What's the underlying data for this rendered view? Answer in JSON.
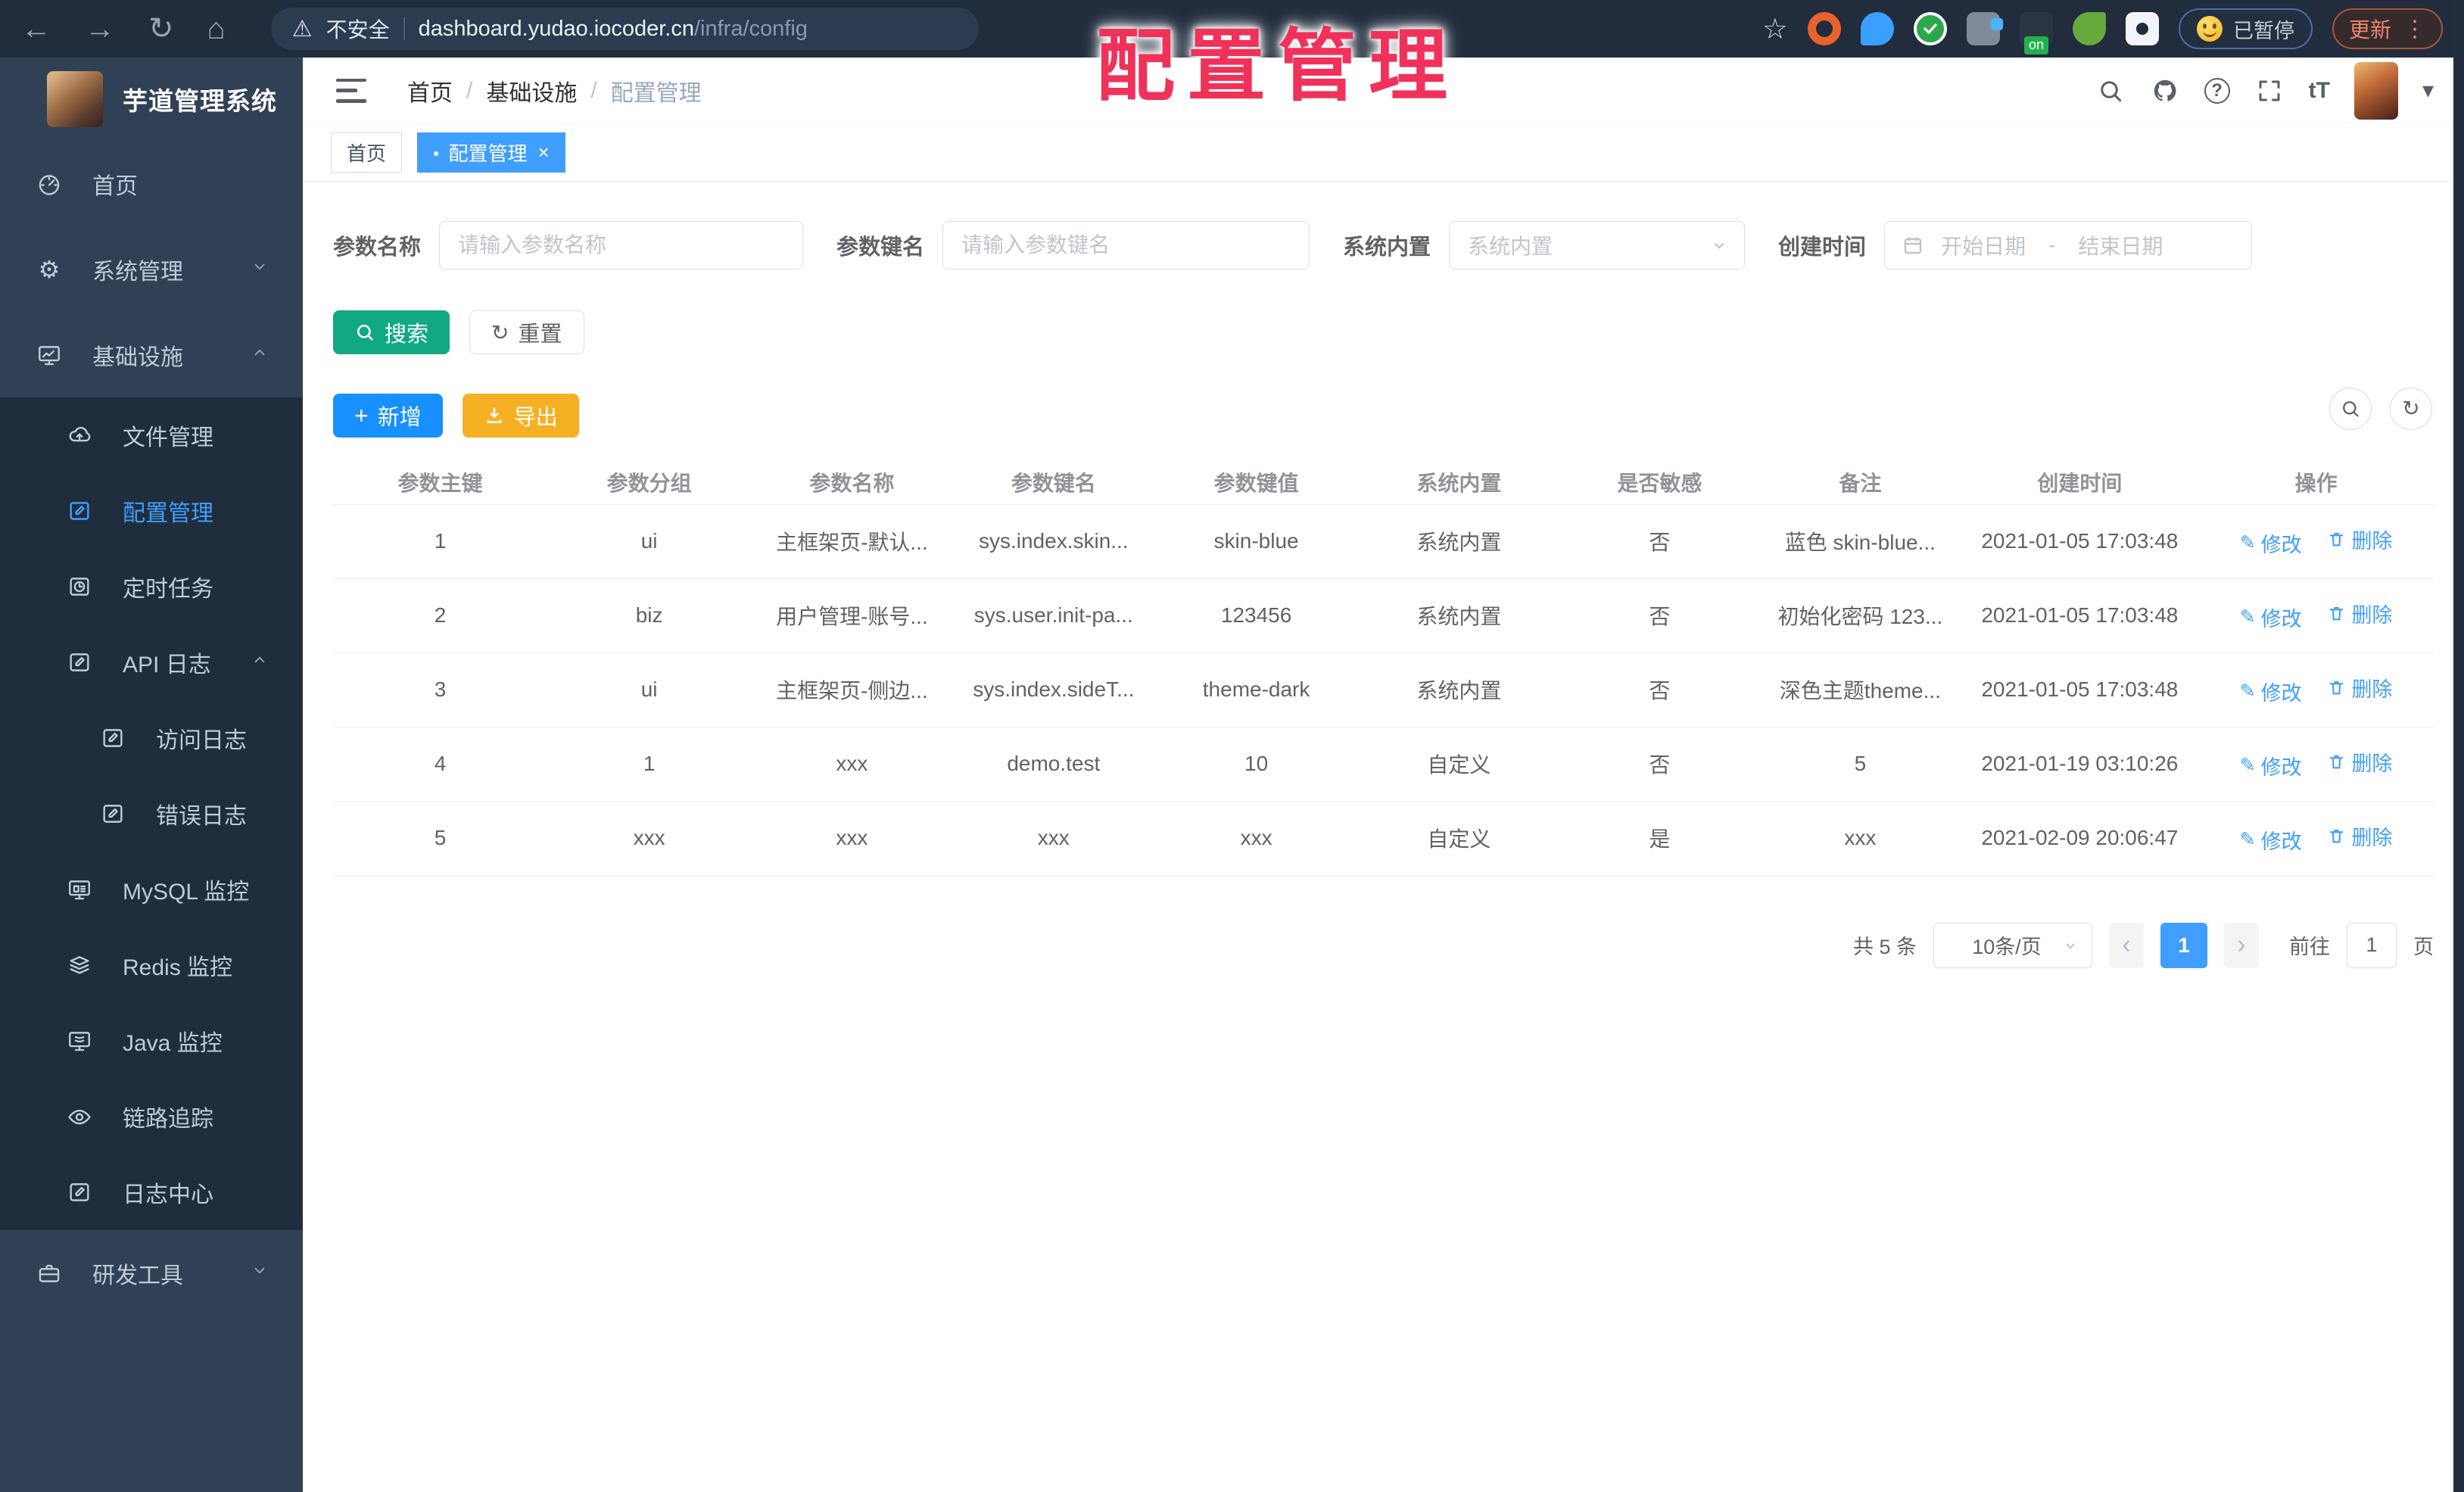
{
  "glyphs": {
    "back": "←",
    "forward": "→",
    "reload": "↻",
    "home": "⌂",
    "warning": "⚠",
    "star": "☆",
    "kebab": "⋮",
    "close": "×",
    "dot": "●",
    "caret": "▾",
    "slash": "/",
    "prev": "‹",
    "next": "›",
    "font_size": "tT",
    "help": "?",
    "gear": "⚙",
    "cloud": "☁",
    "pencil": "✎",
    "plus": "+",
    "range_sep": "-"
  },
  "colors": {
    "browser_bar": "#212c3c",
    "sidebar": "#304156",
    "submenu": "#1f2d3d",
    "accent_blue": "#409eff",
    "add_blue": "#1890ff",
    "search_teal": "#11a983",
    "export_orange": "#f6b024",
    "overlay_red": "#f0325a"
  },
  "browser": {
    "security_label": "不安全",
    "url_host": "dashboard.yudao.iocoder.cn",
    "url_path": "/infra/config",
    "ext_badge": "on",
    "paused_label": "已暂停",
    "update_label": "更新"
  },
  "overlay": {
    "title": "配置管理"
  },
  "sidebar": {
    "app_title": "芋道管理系统",
    "items": [
      {
        "label": "首页"
      },
      {
        "label": "系统管理"
      },
      {
        "label": "基础设施"
      },
      {
        "label": "文件管理"
      },
      {
        "label": "配置管理"
      },
      {
        "label": "定时任务"
      },
      {
        "label": "API 日志"
      },
      {
        "label": "访问日志"
      },
      {
        "label": "错误日志"
      },
      {
        "label": "MySQL 监控"
      },
      {
        "label": "Redis 监控"
      },
      {
        "label": "Java 监控"
      },
      {
        "label": "链路追踪"
      },
      {
        "label": "日志中心"
      },
      {
        "label": "研发工具"
      }
    ]
  },
  "navbar": {
    "breadcrumb": [
      "首页",
      "基础设施",
      "配置管理"
    ]
  },
  "tags": [
    {
      "label": "首页"
    },
    {
      "label": "配置管理"
    }
  ],
  "filters": {
    "param_name": {
      "label": "参数名称",
      "placeholder": "请输入参数名称"
    },
    "param_key": {
      "label": "参数键名",
      "placeholder": "请输入参数键名"
    },
    "builtin": {
      "label": "系统内置",
      "placeholder": "系统内置"
    },
    "create_time": {
      "label": "创建时间",
      "start_placeholder": "开始日期",
      "end_placeholder": "结束日期"
    }
  },
  "actions": {
    "search": "搜索",
    "reset": "重置",
    "add": "新增",
    "export": "导出"
  },
  "table": {
    "headers": [
      "参数主键",
      "参数分组",
      "参数名称",
      "参数键名",
      "参数键值",
      "系统内置",
      "是否敏感",
      "备注",
      "创建时间",
      "操作"
    ],
    "row_actions": {
      "edit": "修改",
      "delete": "删除"
    },
    "rows": [
      {
        "cells": [
          "1",
          "ui",
          "主框架页-默认...",
          "sys.index.skin...",
          "skin-blue",
          "系统内置",
          "否",
          "蓝色 skin-blue...",
          "2021-01-05 17:03:48"
        ]
      },
      {
        "cells": [
          "2",
          "biz",
          "用户管理-账号...",
          "sys.user.init-pa...",
          "123456",
          "系统内置",
          "否",
          "初始化密码 123...",
          "2021-01-05 17:03:48"
        ]
      },
      {
        "cells": [
          "3",
          "ui",
          "主框架页-侧边...",
          "sys.index.sideT...",
          "theme-dark",
          "系统内置",
          "否",
          "深色主题theme...",
          "2021-01-05 17:03:48"
        ]
      },
      {
        "cells": [
          "4",
          "1",
          "xxx",
          "demo.test",
          "10",
          "自定义",
          "否",
          "5",
          "2021-01-19 03:10:26"
        ]
      },
      {
        "cells": [
          "5",
          "xxx",
          "xxx",
          "xxx",
          "xxx",
          "自定义",
          "是",
          "xxx",
          "2021-02-09 20:06:47"
        ]
      }
    ]
  },
  "pagination": {
    "total": "共 5 条",
    "page_size": "10条/页",
    "page": "1",
    "goto_label": "前往",
    "goto_value": "1",
    "unit": "页"
  }
}
